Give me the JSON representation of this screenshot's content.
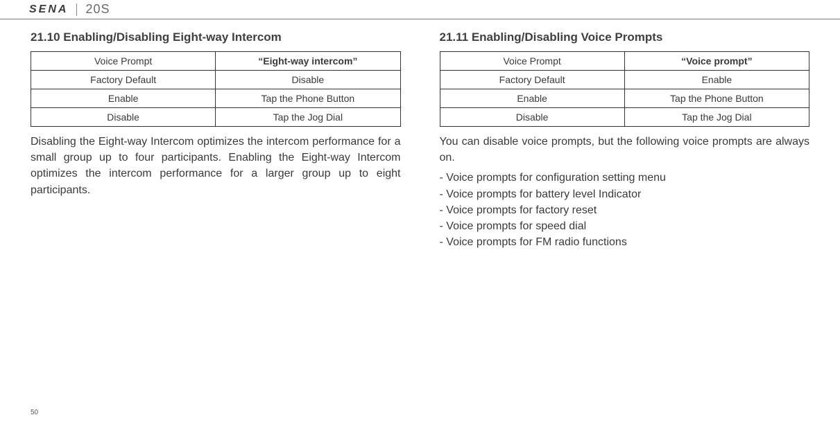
{
  "header": {
    "brand": "SENA",
    "model": "20S"
  },
  "left": {
    "title": "21.10 Enabling/Disabling Eight-way Intercom",
    "table": {
      "rows": [
        {
          "k": "Voice Prompt",
          "v": "“Eight-way intercom”",
          "vbold": true
        },
        {
          "k": "Factory Default",
          "v": "Disable"
        },
        {
          "k": "Enable",
          "v": "Tap the Phone Button"
        },
        {
          "k": "Disable",
          "v": "Tap the Jog Dial"
        }
      ]
    },
    "body": "Disabling the Eight-way Intercom optimizes the intercom performance for a small group up to four participants. Enabling the Eight-way Intercom optimizes the intercom performance for a larger group up to eight participants."
  },
  "right": {
    "title": "21.11 Enabling/Disabling Voice Prompts",
    "table": {
      "rows": [
        {
          "k": "Voice Prompt",
          "v": "“Voice prompt”",
          "vbold": true
        },
        {
          "k": "Factory Default",
          "v": "Enable"
        },
        {
          "k": "Enable",
          "v": "Tap the Phone Button"
        },
        {
          "k": "Disable",
          "v": "Tap the Jog Dial"
        }
      ]
    },
    "body": "You can disable voice prompts, but the following voice prompts are always on.",
    "list": [
      "- Voice prompts for configuration setting menu",
      "- Voice prompts for battery level Indicator",
      "- Voice prompts for factory reset",
      "- Voice prompts for speed dial",
      "- Voice prompts for FM radio functions"
    ]
  },
  "pageNumber": "50"
}
